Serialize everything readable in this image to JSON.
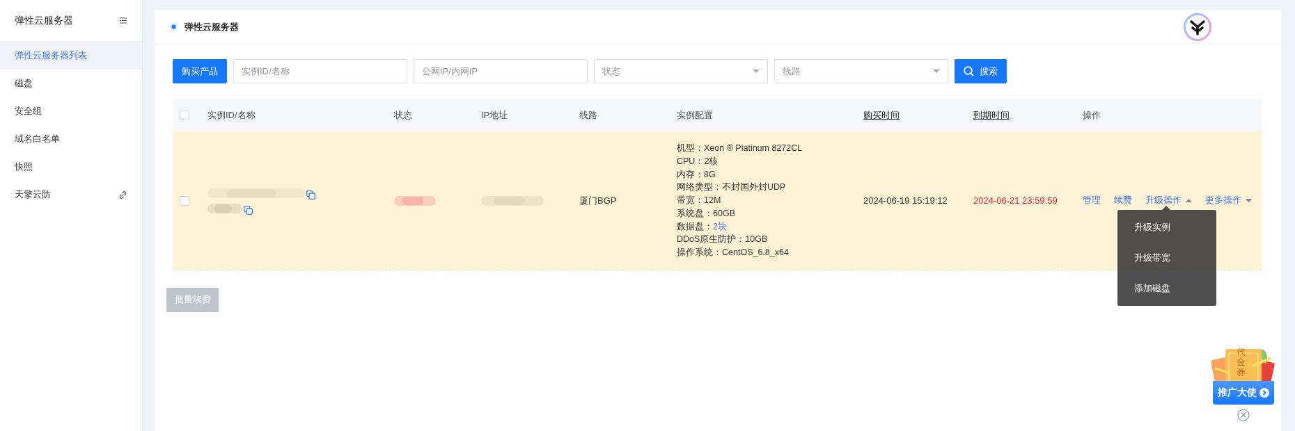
{
  "sidebar": {
    "title": "弹性云服务器",
    "items": [
      {
        "label": "弹性云服务器列表",
        "selected": true,
        "kind": "page"
      },
      {
        "label": "磁盘",
        "selected": false,
        "kind": "page"
      },
      {
        "label": "安全组",
        "selected": false,
        "kind": "page"
      },
      {
        "label": "域名白名单",
        "selected": false,
        "kind": "page"
      },
      {
        "label": "快照",
        "selected": false,
        "kind": "page"
      },
      {
        "label": "天擎云防",
        "selected": false,
        "kind": "external"
      }
    ]
  },
  "panel": {
    "title": "弹性云服务器"
  },
  "toolbar": {
    "buy_button": "购买产品",
    "id_search": {
      "placeholder": "实例ID/名称"
    },
    "ip_search": {
      "placeholder": "公网IP/内网IP"
    },
    "status_select": {
      "placeholder": "状态"
    },
    "line_select": {
      "placeholder": "线路"
    },
    "search_button": "搜索"
  },
  "table": {
    "select_all": {
      "checked": false
    },
    "columns": [
      {
        "label": "实例ID/名称",
        "sortable": false
      },
      {
        "label": "状态",
        "sortable": false
      },
      {
        "label": "IP地址",
        "sortable": false
      },
      {
        "label": "线路",
        "sortable": false
      },
      {
        "label": "实例配置",
        "sortable": false
      },
      {
        "label": "购买时间",
        "sortable": true
      },
      {
        "label": "到期时间",
        "sortable": true
      },
      {
        "label": "操作",
        "sortable": false
      }
    ],
    "rows": [
      {
        "checked": false,
        "line": "厦门BGP",
        "config": [
          {
            "label": "机型：",
            "value": "Xeon ® Platinum 8272CL",
            "kind": "text"
          },
          {
            "label": "CPU：",
            "value": "2核",
            "kind": "text"
          },
          {
            "label": "内存：",
            "value": "8G",
            "kind": "text"
          },
          {
            "label": "网络类型：",
            "value": "不封国外封UDP",
            "kind": "text"
          },
          {
            "label": "带宽：",
            "value": "12M",
            "kind": "text"
          },
          {
            "label": "系统盘：",
            "value": "60GB",
            "kind": "text"
          },
          {
            "label": "数据盘：",
            "value": "2块",
            "kind": "link"
          },
          {
            "label": "DDoS原生防护：",
            "value": "10GB",
            "kind": "text"
          },
          {
            "label": "操作系统：",
            "value": "CentOS_6.8_x64",
            "kind": "text"
          }
        ],
        "purchased": "2024-06-19 15:19:12",
        "expires": "2024-06-21 23:59:59",
        "expiring_soon": true,
        "actions": [
          {
            "label": "管理",
            "kind": "link"
          },
          {
            "label": "续费",
            "kind": "link"
          },
          {
            "label": "升级操作",
            "kind": "menu",
            "expanded": true,
            "menu": [
              "升级实例",
              "升级带宽",
              "添加磁盘"
            ]
          },
          {
            "label": "更多操作",
            "kind": "menu",
            "expanded": false
          }
        ]
      }
    ]
  },
  "batch_button": {
    "label": "批量续费",
    "disabled": true
  },
  "promo": {
    "coupon": "代金券",
    "button": "推广大使"
  }
}
